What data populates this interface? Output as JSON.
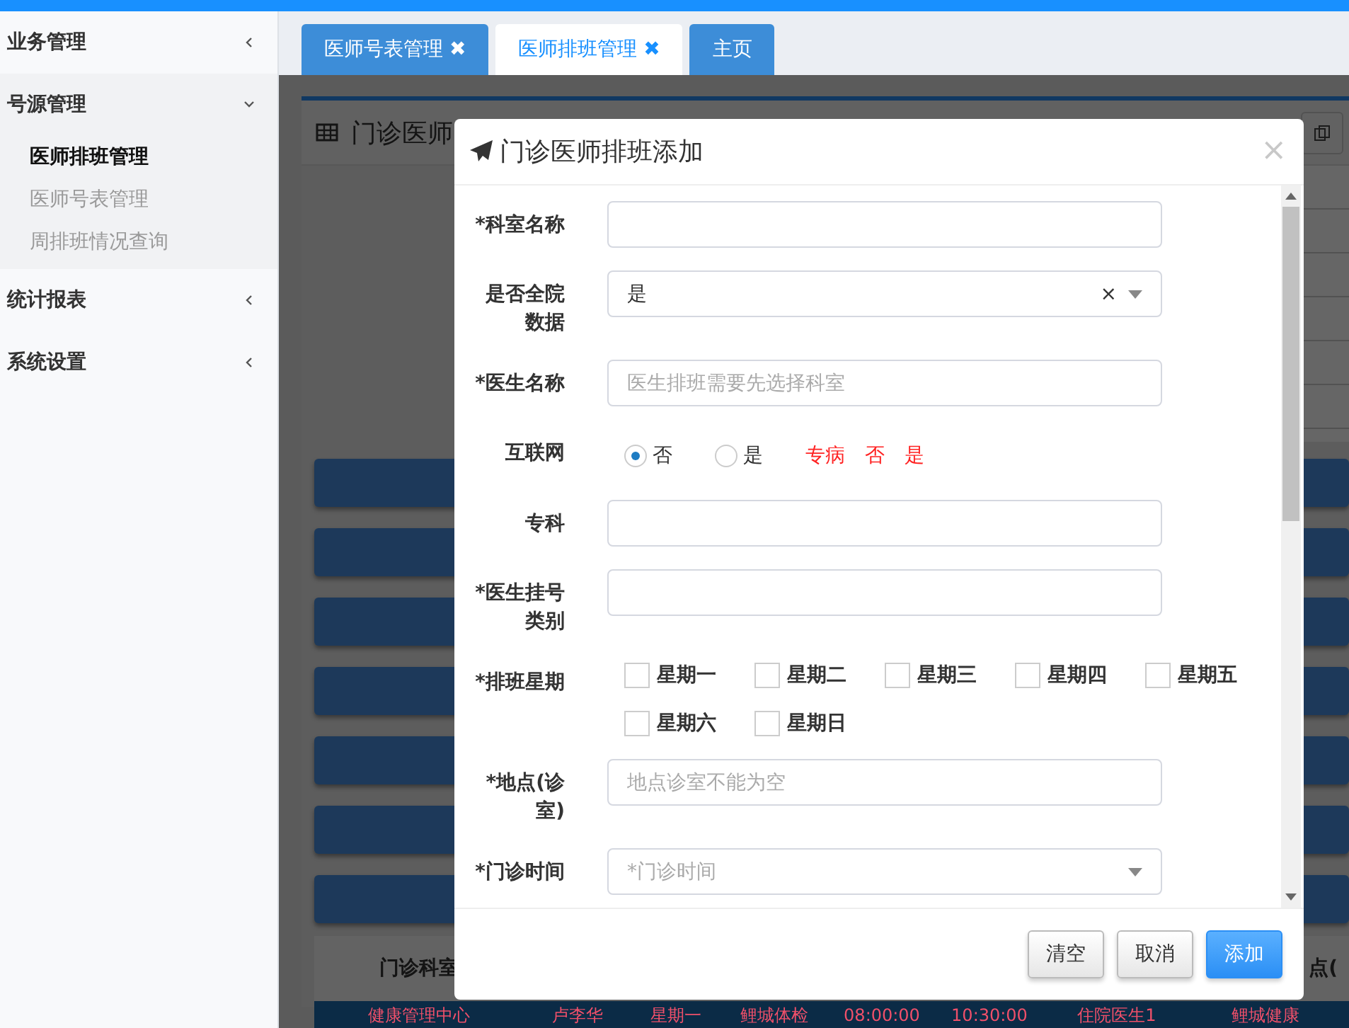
{
  "sidebar": {
    "items": [
      {
        "label": "业务管理",
        "expanded": false
      },
      {
        "label": "号源管理",
        "expanded": true,
        "children": [
          {
            "label": "医师排班管理",
            "selected": true
          },
          {
            "label": "医师号表管理",
            "selected": false
          },
          {
            "label": "周排班情况查询",
            "selected": false
          }
        ]
      },
      {
        "label": "统计报表",
        "expanded": false
      },
      {
        "label": "系统设置",
        "expanded": false
      }
    ]
  },
  "tabs": [
    {
      "label": "医师号表管理",
      "close": "✖",
      "selected": false
    },
    {
      "label": "医师排班管理",
      "close": "✖",
      "selected": true
    },
    {
      "label": "主页",
      "selected": false
    }
  ],
  "background_panel": {
    "title": "门诊医师",
    "table_header": [
      "门诊科室",
      "点("
    ],
    "row": [
      "健康管理中心",
      "卢李华",
      "星期一",
      "鲤城体检",
      "08:00:00",
      "10:30:00",
      "住院医生1",
      "鲤城健康"
    ]
  },
  "dialog": {
    "title": "门诊医师排班添加",
    "close": "×",
    "fields": [
      {
        "kind": "text",
        "label": "*科室名称"
      },
      {
        "kind": "select",
        "label": "是否全院数据",
        "value": "是",
        "clear": "×"
      },
      {
        "kind": "text",
        "label": "*医生名称",
        "placeholder": "医生排班需要先选择科室"
      },
      {
        "kind": "radio",
        "label": "互联网",
        "options": [
          {
            "label": "否",
            "selected": true
          },
          {
            "label": "是",
            "selected": false
          }
        ],
        "note": [
          "专病",
          "否",
          "是"
        ]
      },
      {
        "kind": "text",
        "label": "专科"
      },
      {
        "kind": "text",
        "label": "*医生挂号类别"
      },
      {
        "kind": "checkbox",
        "label": "*排班星期",
        "options": [
          {
            "label": "星期一",
            "checked": false
          },
          {
            "label": "星期二",
            "checked": false
          },
          {
            "label": "星期三",
            "checked": false
          },
          {
            "label": "星期四",
            "checked": false
          },
          {
            "label": "星期五",
            "checked": false
          },
          {
            "label": "星期六",
            "checked": false
          },
          {
            "label": "星期日",
            "checked": false
          }
        ]
      },
      {
        "kind": "text",
        "label": "*地点(诊室)",
        "placeholder": "地点诊室不能为空"
      },
      {
        "kind": "select",
        "label": "*门诊时间",
        "placeholder": "*门诊时间"
      }
    ],
    "buttons": [
      {
        "label": "清空",
        "kind": "default"
      },
      {
        "label": "取消",
        "kind": "default"
      },
      {
        "label": "添加",
        "kind": "primary"
      }
    ]
  }
}
